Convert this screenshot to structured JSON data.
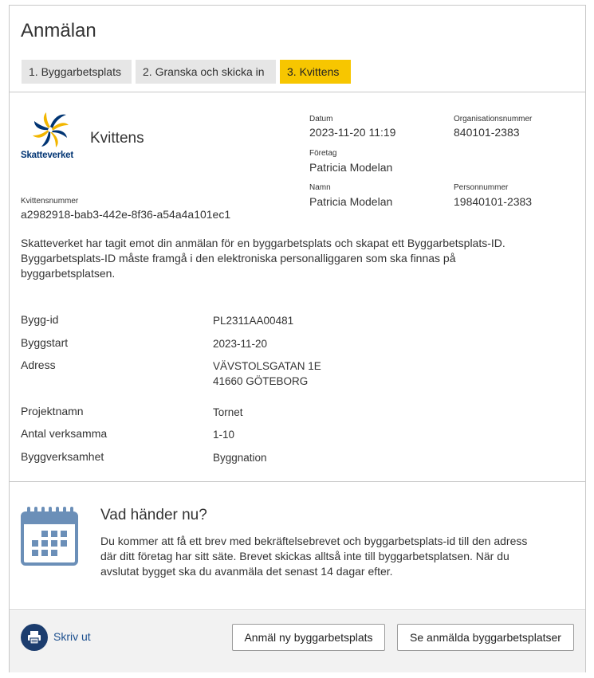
{
  "page": {
    "title": "Anmälan"
  },
  "steps": [
    {
      "label": "1. Byggarbetsplats",
      "state": "done"
    },
    {
      "label": "2. Granska och skicka in",
      "state": "done"
    },
    {
      "label": "3. Kvittens",
      "state": "active"
    }
  ],
  "receipt": {
    "logo_text": "Skatteverket",
    "title": "Kvittens",
    "receipt_number_label": "Kvittensnummer",
    "receipt_number": "a2982918-bab3-442e-8f36-a54a4a101ec1",
    "date_label": "Datum",
    "date": "2023-11-20 11:19",
    "org_number_label": "Organisationsnummer",
    "org_number": "840101-2383",
    "company_label": "Företag",
    "company": "Patricia Modelan",
    "name_label": "Namn",
    "name": "Patricia Modelan",
    "personal_number_label": "Personnummer",
    "personal_number": "19840101-2383",
    "intro_line1": "Skatteverket har tagit emot din anmälan för en byggarbetsplats och skapat ett Byggarbetsplats-ID.",
    "intro_line2": "Byggarbetsplats-ID måste framgå i den elektroniska personalliggaren som ska finnas på",
    "intro_line3": "byggarbetsplatsen."
  },
  "details": {
    "bygg_id": {
      "label": "Bygg-id",
      "value": "PL2311AA00481"
    },
    "byggstart": {
      "label": "Byggstart",
      "value": "2023-11-20"
    },
    "adress": {
      "label": "Adress",
      "line1": "VÄVSTOLSGATAN 1E",
      "line2": "41660 GÖTEBORG"
    },
    "projektnamn": {
      "label": "Projektnamn",
      "value": "Tornet"
    },
    "antal": {
      "label": "Antal verksamma",
      "value": "1-10"
    },
    "byggverksamhet": {
      "label": "Byggverksamhet",
      "value": "Byggnation"
    }
  },
  "next": {
    "title": "Vad händer nu?",
    "line1": "Du kommer att få ett brev med bekräftelsebrevet och byggarbetsplats-id till den adress",
    "line2": "där ditt företag har sitt säte. Brevet skickas alltså inte till byggarbetsplatsen. När du",
    "line3": "avslutat bygget ska du avanmäla det senast 14 dagar efter."
  },
  "footer": {
    "print_label": "Skriv ut",
    "new_label": "Anmäl ny byggarbetsplats",
    "see_label": "Se anmälda byggarbetsplatser"
  },
  "colors": {
    "active_step": "#f7c600",
    "inactive_step": "#e6e6e6",
    "brand_blue": "#1c3d6e",
    "calendar_blue": "#6b8fb8"
  },
  "icons": {
    "logo": "skatteverket-logo",
    "calendar": "calendar-icon",
    "print": "printer-icon"
  }
}
